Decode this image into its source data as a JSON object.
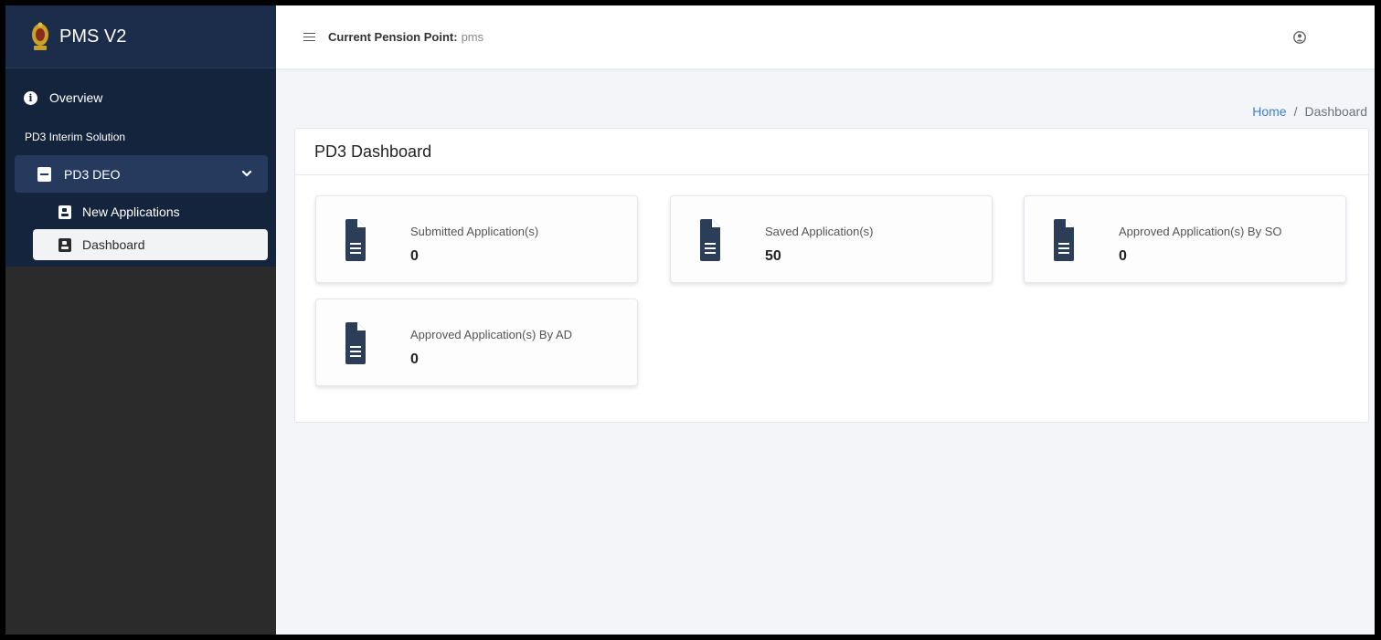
{
  "brand": {
    "name": "PMS V2",
    "logo_icon": "emblem-logo"
  },
  "sidebar": {
    "overview_label": "Overview",
    "section_label": "PD3 Interim Solution",
    "group": {
      "label": "PD3 DEO",
      "icon": "document-icon",
      "expanded": true
    },
    "items": [
      {
        "label": "New Applications",
        "icon": "contact-card-icon",
        "active": false
      },
      {
        "label": "Dashboard",
        "icon": "contact-card-icon",
        "active": true
      }
    ]
  },
  "topbar": {
    "pension_label": "Current Pension Point:",
    "pension_value": "pms",
    "user_icon": "user-circle-icon"
  },
  "breadcrumb": {
    "home": "Home",
    "separator": "/",
    "current": "Dashboard"
  },
  "panel": {
    "title": "PD3 Dashboard"
  },
  "cards": [
    {
      "label": "Submitted Application(s)",
      "value": "0"
    },
    {
      "label": "Saved Application(s)",
      "value": "50"
    },
    {
      "label": "Approved Application(s) By SO",
      "value": "0"
    },
    {
      "label": "Approved Application(s) By AD",
      "value": "0"
    }
  ],
  "colors": {
    "sidebar_top": "#14243d",
    "sidebar_bottom": "#2b2b2b",
    "accent_link": "#3f7fd0",
    "card_icon": "#2c3e57"
  }
}
